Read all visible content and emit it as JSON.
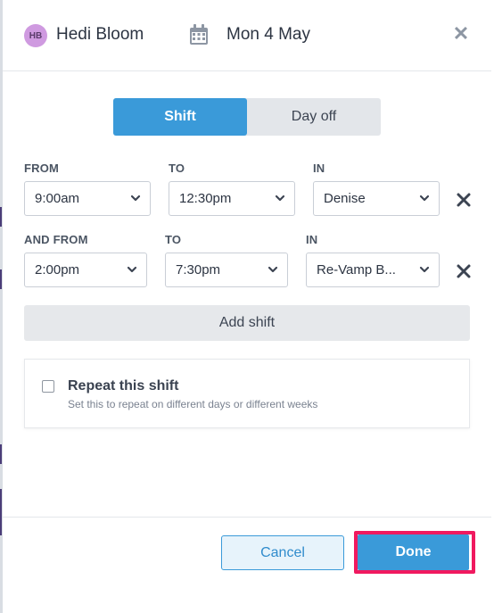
{
  "header": {
    "avatar_initials": "HB",
    "person_name": "Hedi Bloom",
    "date": "Mon 4 May",
    "close_icon": "close-icon",
    "calendar_icon": "calendar-icon"
  },
  "mode_toggle": {
    "options": [
      {
        "label": "Shift",
        "selected": true
      },
      {
        "label": "Day off",
        "selected": false
      }
    ]
  },
  "shifts": [
    {
      "from_label": "FROM",
      "to_label": "TO",
      "in_label": "IN",
      "from_value": "9:00am",
      "to_value": "12:30pm",
      "in_value": "Denise"
    },
    {
      "from_label": "AND FROM",
      "to_label": "TO",
      "in_label": "IN",
      "from_value": "2:00pm",
      "to_value": "7:30pm",
      "in_value": "Re-Vamp B..."
    }
  ],
  "add_shift_label": "Add shift",
  "repeat": {
    "checked": false,
    "title": "Repeat this shift",
    "description": "Set this to repeat on different days or different weeks"
  },
  "footer": {
    "cancel_label": "Cancel",
    "done_label": "Done"
  },
  "colors": {
    "accent": "#3a9ad9",
    "highlight": "#f0195f",
    "avatar": "#cf9ae0"
  }
}
